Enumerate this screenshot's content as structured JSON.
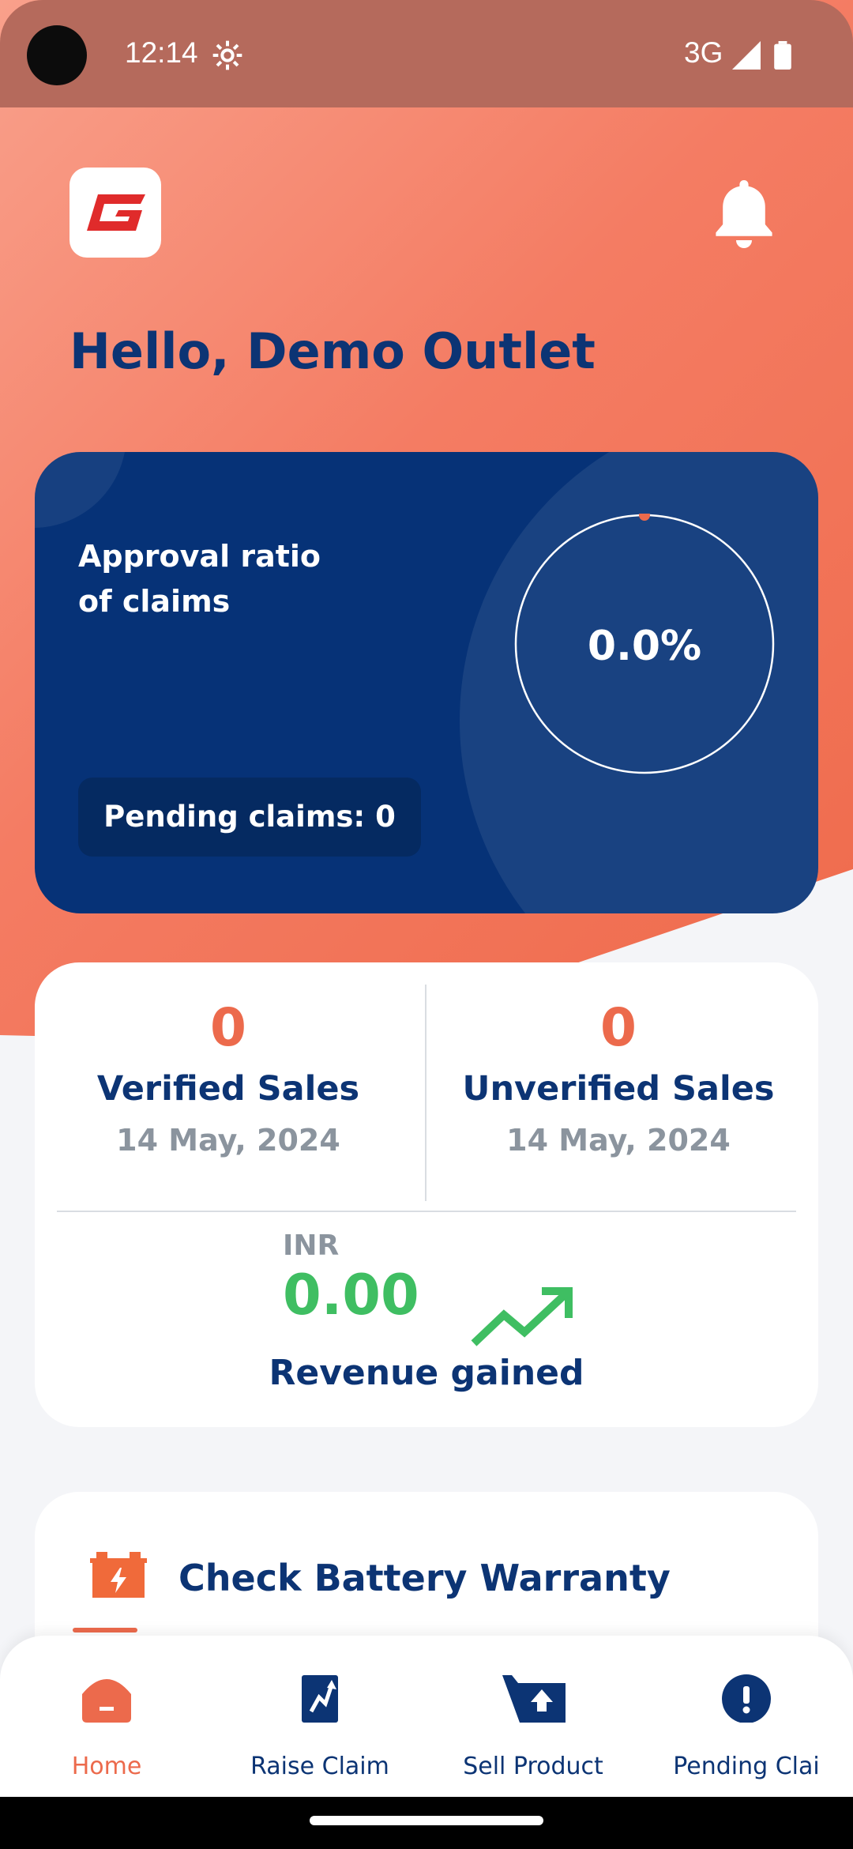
{
  "status_bar": {
    "time": "12:14",
    "network": "3G"
  },
  "header": {
    "greeting": "Hello, Demo Outlet"
  },
  "approval_card": {
    "title": "Approval ratio of claims",
    "ratio_text": "0.0%",
    "ratio_value": 0.0,
    "pending_label": "Pending claims: 0"
  },
  "stats": {
    "verified": {
      "count": "0",
      "label": "Verified Sales",
      "date": "14 May, 2024"
    },
    "unverified": {
      "count": "0",
      "label": "Unverified Sales",
      "date": "14 May, 2024"
    },
    "currency": "INR",
    "revenue": "0.00",
    "revenue_label": "Revenue gained"
  },
  "warranty": {
    "title": "Check Battery Warranty"
  },
  "nav": {
    "items": [
      {
        "label": "Home",
        "icon": "home-icon",
        "active": true
      },
      {
        "label": "Raise Claim",
        "icon": "raise-claim-icon",
        "active": false
      },
      {
        "label": "Sell Product",
        "icon": "sell-product-icon",
        "active": false
      },
      {
        "label": "Pending Clai",
        "icon": "alert-icon",
        "active": false
      }
    ]
  },
  "colors": {
    "brand_orange": "#ec6a4c",
    "navy": "#0c3474",
    "card_blue": "#063277",
    "revenue_green": "#3fbe62",
    "muted_gray": "#8b949e"
  }
}
